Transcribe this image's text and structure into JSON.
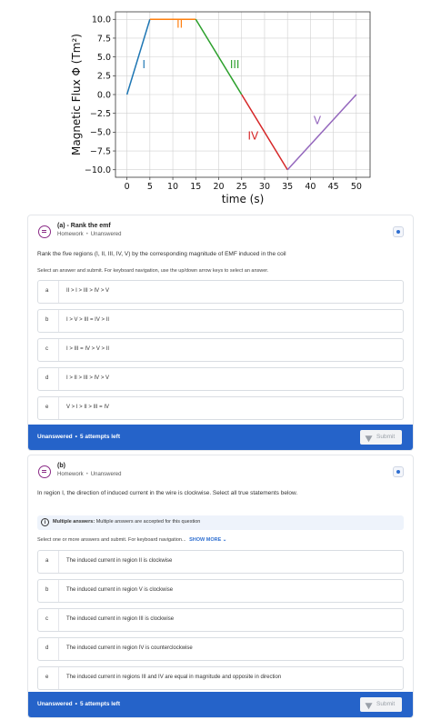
{
  "chart_data": {
    "type": "line",
    "x": [
      0,
      5,
      15,
      25,
      35,
      50
    ],
    "y": [
      0,
      10,
      10,
      0,
      -10,
      0
    ],
    "segments": [
      {
        "name": "I",
        "x": [
          0,
          5
        ],
        "y": [
          0,
          10
        ],
        "color": "#1f77b4"
      },
      {
        "name": "II",
        "x": [
          5,
          15
        ],
        "y": [
          10,
          10
        ],
        "color": "#ff7f0e"
      },
      {
        "name": "III",
        "x": [
          15,
          25
        ],
        "y": [
          10,
          0
        ],
        "color": "#2ca02c"
      },
      {
        "name": "IV",
        "x": [
          25,
          35
        ],
        "y": [
          0,
          -10
        ],
        "color": "#d62728"
      },
      {
        "name": "V",
        "x": [
          35,
          50
        ],
        "y": [
          -10,
          0
        ],
        "color": "#9467bd"
      }
    ],
    "xlabel": "time (s)",
    "ylabel": "Magnetic Flux Φ  (Tm²)",
    "xlim": [
      -2.5,
      53
    ],
    "ylim": [
      -11,
      11
    ],
    "xticks": [
      0,
      5,
      10,
      15,
      20,
      25,
      30,
      35,
      40,
      45,
      50
    ],
    "yticks": [
      10.0,
      7.5,
      5.0,
      2.5,
      0.0,
      -2.5,
      -5.0,
      -7.5,
      -10.0
    ],
    "ytick_labels": [
      "10.0",
      "7.5",
      "5.0",
      "2.5",
      "0.0",
      "−2.5",
      "−5.0",
      "−7.5",
      "−10.0"
    ],
    "grid": true,
    "annotations": [
      {
        "text": "I",
        "x": 3.7,
        "y": 3.5
      },
      {
        "text": "II",
        "x": 11.5,
        "y": 8.9
      },
      {
        "text": "III",
        "x": 23.5,
        "y": 3.5
      },
      {
        "text": "IV",
        "x": 27.5,
        "y": -6.0
      },
      {
        "text": "V",
        "x": 41.5,
        "y": -3.9
      }
    ]
  },
  "questions": [
    {
      "title": "(a) - Rank the emf",
      "meta_type": "Homework",
      "meta_status": "Unanswered",
      "prompt": "Rank the five regions (I, II, III, IV, V) by the corresponding magnitude of EMF induced in the coil",
      "instructions": "Select an answer and submit. For keyboard navigation, use the up/down arrow keys to select an answer.",
      "options": [
        {
          "letter": "a",
          "label": "II > I > III > IV > V"
        },
        {
          "letter": "b",
          "label": "I > V > III = IV > II"
        },
        {
          "letter": "c",
          "label": "I > III = IV > V > II"
        },
        {
          "letter": "d",
          "label": "I > II > III > IV > V"
        },
        {
          "letter": "e",
          "label": "V > I > II > III = IV"
        }
      ],
      "footer_status": "Unanswered",
      "attempts": "5 attempts left",
      "submit_label": "Submit"
    },
    {
      "title": "(b)",
      "meta_type": "Homework",
      "meta_status": "Unanswered",
      "prompt": "In region I, the direction of induced current in the wire is clockwise. Select all true statements below.",
      "note_bold": "Multiple answers:",
      "note_text": "Multiple answers are accepted for this question",
      "instructions": "Select one or more answers and submit. For keyboard navigation...",
      "show_more": "SHOW MORE",
      "options": [
        {
          "letter": "a",
          "label": "The induced current in region II is clockwise"
        },
        {
          "letter": "b",
          "label": "The induced current in region V is clockwise"
        },
        {
          "letter": "c",
          "label": "The induced current in region III is clockwise"
        },
        {
          "letter": "d",
          "label": "The induced current in region IV is counterclockwise"
        },
        {
          "letter": "e",
          "label": "The induced current in regions III and IV are equal in magnitude and opposite in direction"
        }
      ],
      "footer_status": "Unanswered",
      "attempts": "5 attempts left",
      "submit_label": "Submit"
    }
  ],
  "colors": {
    "accent": "#2563c9",
    "question_icon": "#8a2b86"
  },
  "icons": {
    "question": "question-list-icon",
    "settings": "settings-badge-icon",
    "info": "info-icon",
    "submit": "send-icon",
    "chevron": "chevron-down-icon"
  }
}
